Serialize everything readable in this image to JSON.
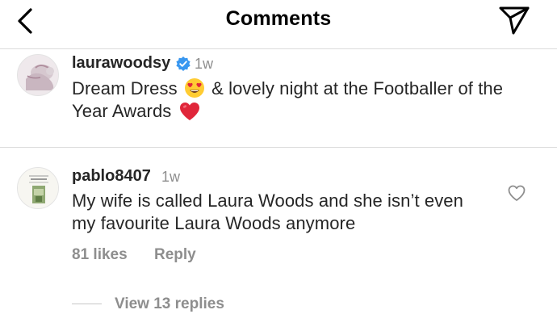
{
  "header": {
    "title": "Comments",
    "back_icon": "chevron-left-icon",
    "action_icon": "send-icon"
  },
  "post_caption": {
    "username": "laurawoodsy",
    "verified": true,
    "time": "1w",
    "text_part1": "Dream Dress ",
    "emoji_1": "smiling-face-with-heart-eyes",
    "text_part2": " & lovely night at the Footballer of the Year Awards ",
    "emoji_2": "red-heart"
  },
  "comments": [
    {
      "username": "pablo8407",
      "time": "1w",
      "text": "My wife is called Laura Woods and she isn’t even my favourite Laura Woods anymore",
      "likes": "81 likes",
      "reply_label": "Reply",
      "view_replies": "View 13 replies"
    }
  ],
  "colors": {
    "primary_text": "#262626",
    "secondary_text": "#8e8e8e",
    "divider": "#dbdbdb",
    "verified_badge": "#3897f0",
    "heart_red": "#e0263a"
  }
}
